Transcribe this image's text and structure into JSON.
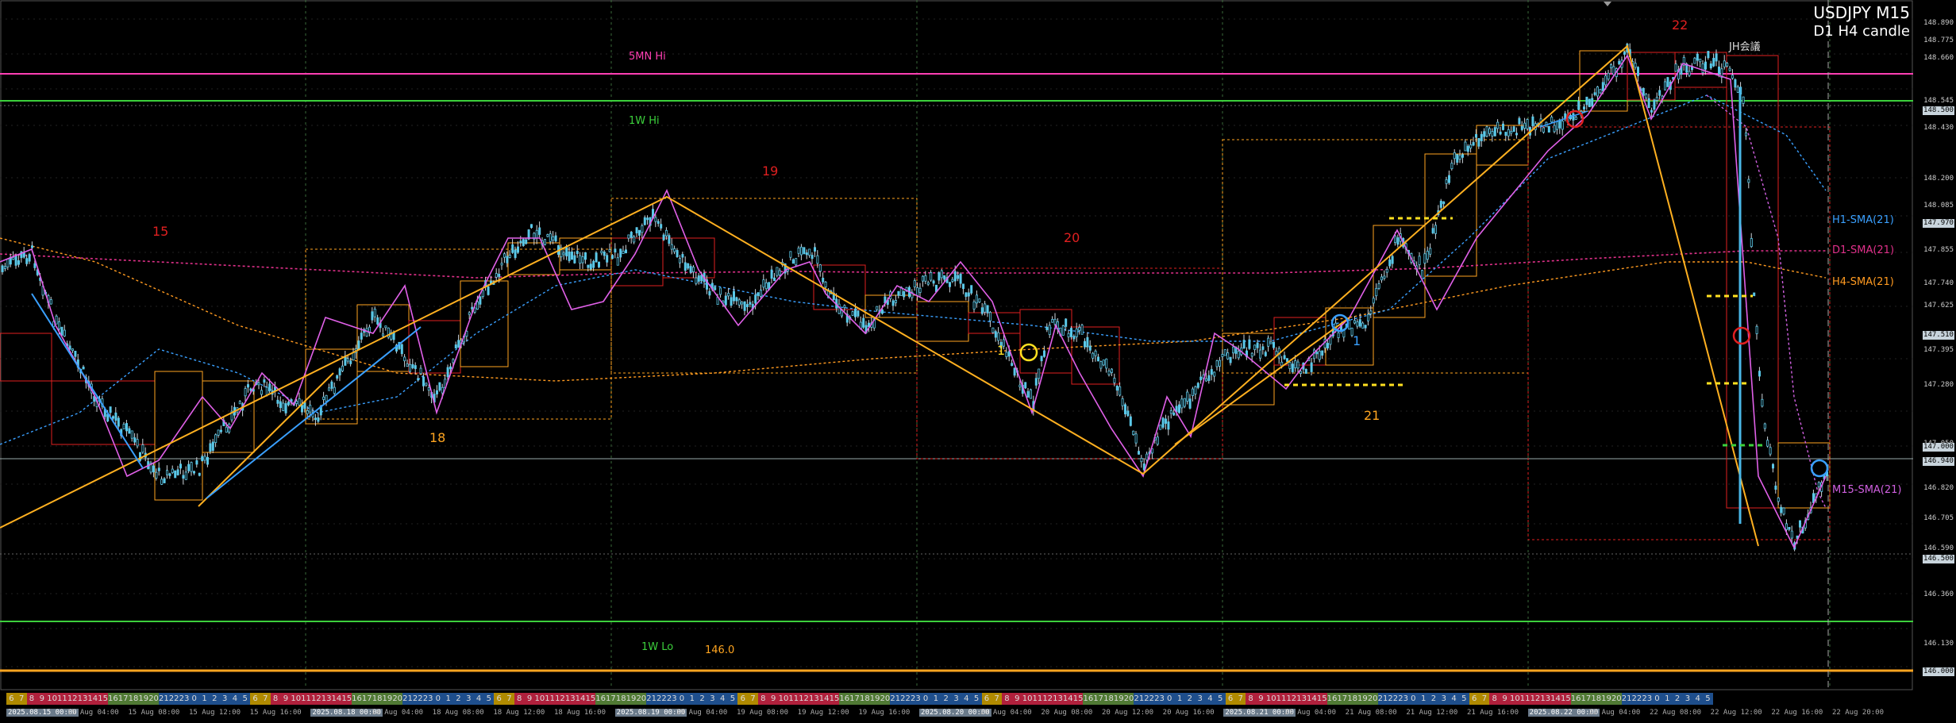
{
  "window": {
    "symbol": "USDJPY M15",
    "subtitle": "D1 H4 candle"
  },
  "price_axis": {
    "ticks": [
      "148.890",
      "148.775",
      "148.660",
      "148.545",
      "148.430",
      "148.200",
      "148.085",
      "147.855",
      "147.740",
      "147.625",
      "147.395",
      "147.280",
      "147.050",
      "146.820",
      "146.705",
      "146.590",
      "146.360",
      "146.130",
      "145.900"
    ],
    "tags": [
      {
        "text": "148.500",
        "color": "#c8d4dc"
      },
      {
        "text": "147.970",
        "color": "#c8d4dc"
      },
      {
        "text": "147.510",
        "color": "#c8d4dc"
      },
      {
        "text": "147.000",
        "color": "#c8d4dc"
      },
      {
        "text": "146.940",
        "color": "#c8d4dc"
      },
      {
        "text": "146.500",
        "color": "#c8d4dc"
      },
      {
        "text": "146.000",
        "color": "#c8d4dc"
      }
    ]
  },
  "levels": {
    "mn5_hi": {
      "label": "5MN Hi",
      "color": "#ff3fb4"
    },
    "w1_hi": {
      "label": "1W Hi",
      "color": "#3cd03c"
    },
    "w1_lo": {
      "label": "1W Lo",
      "color": "#3cd03c"
    },
    "l146": {
      "label": "146.0",
      "color": "#ffa520"
    }
  },
  "swing_labels": {
    "s15": "15",
    "s18": "18",
    "s19": "19",
    "s20": "20",
    "s21": "21",
    "s22": "22",
    "s1y": "1",
    "s1b": "1"
  },
  "event": {
    "jh": "JH会議"
  },
  "indicators": {
    "h1": {
      "label": "H1-SMA(21)",
      "color": "#3aa0ff"
    },
    "d1": {
      "label": "D1-SMA(21)",
      "color": "#e0308a"
    },
    "h4": {
      "label": "H4-SMA(21)",
      "color": "#ff9a20"
    },
    "m15": {
      "label": "M15-SMA(21)",
      "color": "#d060e0"
    }
  },
  "session_hours": [
    "6",
    "7",
    "8",
    "9",
    "10",
    "11",
    "12",
    "13",
    "14",
    "15",
    "16",
    "17",
    "18",
    "19",
    "20",
    "21",
    "22",
    "23",
    "0",
    "1",
    "2",
    "3",
    "4",
    "5"
  ],
  "session_colors": {
    "tokyo": "#b08a00",
    "london": "#b0203c",
    "ny": "#507a34",
    "late": "#1e4e8c"
  },
  "time_labels": [
    {
      "text": "2025.08.15 00:00",
      "hl": true
    },
    {
      "text": "15 Aug 04:00"
    },
    {
      "text": "15 Aug 08:00"
    },
    {
      "text": "15 Aug 12:00"
    },
    {
      "text": "15 Aug 16:00"
    },
    {
      "text": "2025.08.18 00:00",
      "hl": true
    },
    {
      "text": "18 Aug 04:00"
    },
    {
      "text": "18 Aug 08:00"
    },
    {
      "text": "18 Aug 12:00"
    },
    {
      "text": "18 Aug 16:00"
    },
    {
      "text": "2025.08.19 00:00",
      "hl": true
    },
    {
      "text": "19 Aug 04:00"
    },
    {
      "text": "19 Aug 08:00"
    },
    {
      "text": "19 Aug 12:00"
    },
    {
      "text": "19 Aug 16:00"
    },
    {
      "text": "2025.08.20 00:00",
      "hl": true
    },
    {
      "text": "20 Aug 04:00"
    },
    {
      "text": "20 Aug 08:00"
    },
    {
      "text": "20 Aug 12:00"
    },
    {
      "text": "20 Aug 16:00"
    },
    {
      "text": "2025.08.21 00:00",
      "hl": true
    },
    {
      "text": "21 Aug 04:00"
    },
    {
      "text": "21 Aug 08:00"
    },
    {
      "text": "21 Aug 12:00"
    },
    {
      "text": "21 Aug 16:00"
    },
    {
      "text": "2025.08.22 00:00",
      "hl": true
    },
    {
      "text": "22 Aug 04:00"
    },
    {
      "text": "22 Aug 08:00"
    },
    {
      "text": "22 Aug 12:00"
    },
    {
      "text": "22 Aug 16:00"
    },
    {
      "text": "22 Aug 20:00"
    }
  ]
}
